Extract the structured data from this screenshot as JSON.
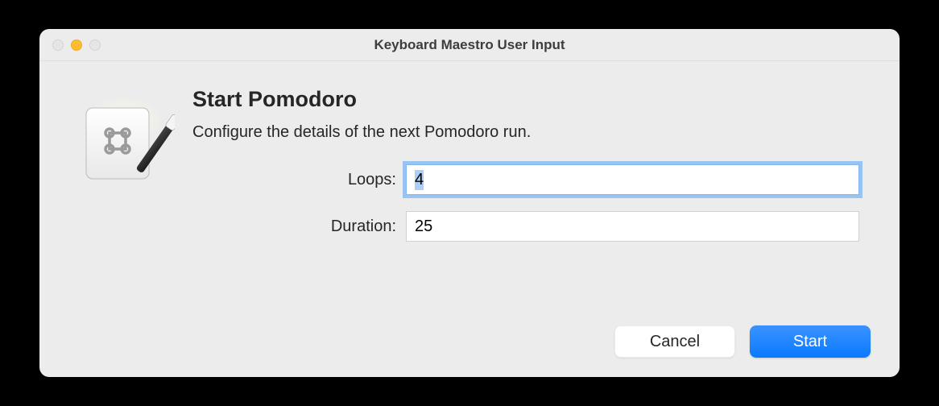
{
  "window": {
    "title": "Keyboard Maestro User Input"
  },
  "dialog": {
    "heading": "Start Pomodoro",
    "description": "Configure the details of the next Pomodoro run."
  },
  "fields": {
    "loops": {
      "label": "Loops:",
      "value": "4"
    },
    "duration": {
      "label": "Duration:",
      "value": "25"
    }
  },
  "buttons": {
    "cancel": "Cancel",
    "start": "Start"
  }
}
